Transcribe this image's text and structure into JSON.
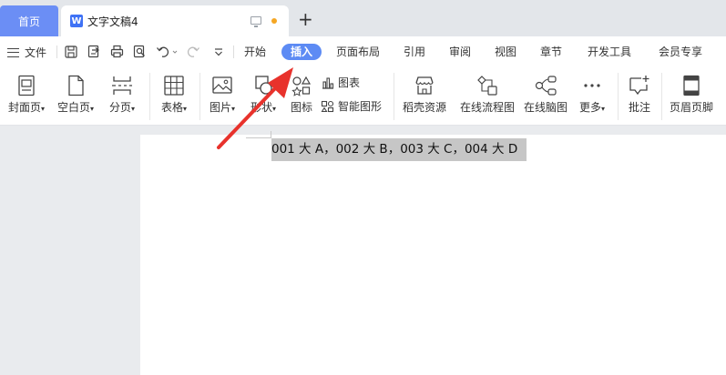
{
  "tabs": {
    "home": "首页",
    "doc_logo": "W",
    "doc_title": "文字文稿4",
    "new_tab": "+"
  },
  "menubar": {
    "file": "文件",
    "tabs": [
      "开始",
      "插入",
      "页面布局",
      "引用",
      "审阅",
      "视图",
      "章节",
      "开发工具",
      "会员专享"
    ],
    "active_tab": "插入",
    "quick_icons": [
      "save-icon",
      "export-icon",
      "print-icon",
      "print-preview-icon",
      "undo-icon",
      "redo-icon",
      "customize-icon"
    ]
  },
  "ribbon": {
    "cover": "封面页",
    "blank": "空白页",
    "page_break": "分页",
    "table": "表格",
    "picture": "图片",
    "shape": "形状",
    "icon": "图标",
    "chart": "图表",
    "smart_art": "智能图形",
    "resources": "稻壳资源",
    "flowchart": "在线流程图",
    "mindmap": "在线脑图",
    "more": "更多",
    "comment": "批注",
    "header_footer": "页眉页脚"
  },
  "document": {
    "text": "001 大 A，002 大 B，003 大 C，004 大 D"
  },
  "colors": {
    "accent": "#5d8bf4",
    "home_tab": "#6b8ef5",
    "arrow": "#e8322c",
    "selection": "#c6c6c6"
  }
}
